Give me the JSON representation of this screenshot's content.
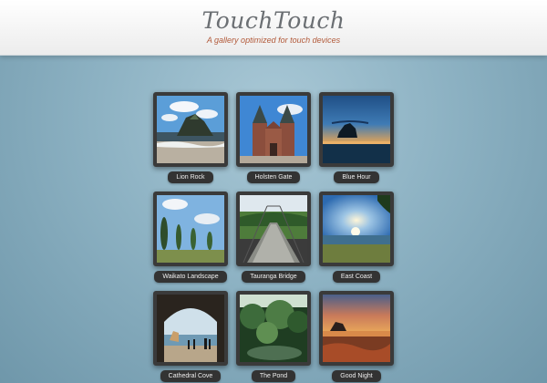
{
  "header": {
    "title": "TouchTouch",
    "subtitle": "A gallery optimized for touch devices"
  },
  "gallery": {
    "items": [
      {
        "caption": "Lion Rock"
      },
      {
        "caption": "Holsten Gate"
      },
      {
        "caption": "Blue Hour"
      },
      {
        "caption": "Waikato Landscape"
      },
      {
        "caption": "Tauranga Bridge"
      },
      {
        "caption": "East Coast"
      },
      {
        "caption": "Cathedral Cove"
      },
      {
        "caption": "The Pond"
      },
      {
        "caption": "Good Night"
      }
    ]
  }
}
